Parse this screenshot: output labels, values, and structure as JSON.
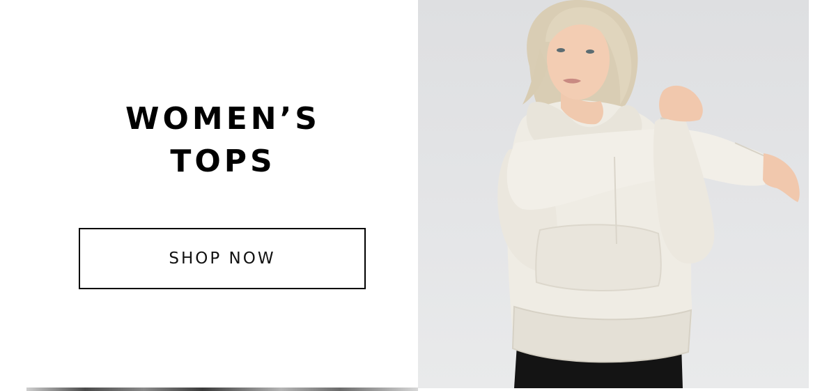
{
  "promo": {
    "heading_line1": "WOMEN’S",
    "heading_line2": "TOPS",
    "cta_label": "SHOP NOW"
  },
  "colors": {
    "text": "#000000",
    "background": "#ffffff",
    "photo_background": "#e2e3e5",
    "hoodie": "#efece4"
  }
}
